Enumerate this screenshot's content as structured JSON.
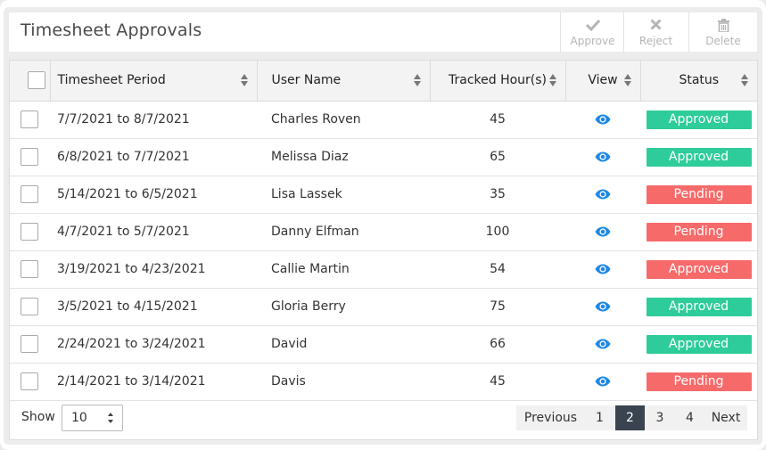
{
  "header": {
    "title": "Timesheet Approvals"
  },
  "toolbar": {
    "approve_label": "Approve",
    "reject_label": "Reject",
    "delete_label": "Delete"
  },
  "table": {
    "columns": {
      "period": "Timesheet Period",
      "user": "User Name",
      "hours": "Tracked Hour(s)",
      "view": "View",
      "status": "Status"
    },
    "rows": [
      {
        "period": "7/7/2021 to 8/7/2021",
        "user": "Charles Roven",
        "hours": "45",
        "status": "Approved",
        "status_color": "#2ecc9a"
      },
      {
        "period": "6/8/2021 to 7/7/2021",
        "user": "Melissa Diaz",
        "hours": "65",
        "status": "Approved",
        "status_color": "#2ecc9a"
      },
      {
        "period": "5/14/2021 to 6/5/2021",
        "user": "Lisa Lassek",
        "hours": "35",
        "status": "Pending",
        "status_color": "#f76a6a"
      },
      {
        "period": "4/7/2021 to 5/7/2021",
        "user": "Danny Elfman",
        "hours": "100",
        "status": "Pending",
        "status_color": "#f76a6a"
      },
      {
        "period": "3/19/2021 to 4/23/2021",
        "user": "Callie Martin",
        "hours": "54",
        "status": "Approved",
        "status_color": "#f76a6a"
      },
      {
        "period": "3/5/2021 to 4/15/2021",
        "user": "Gloria Berry",
        "hours": "75",
        "status": "Approved",
        "status_color": "#2ecc9a"
      },
      {
        "period": "2/24/2021 to 3/24/2021",
        "user": "David",
        "hours": "66",
        "status": "Approved",
        "status_color": "#2ecc9a"
      },
      {
        "period": "2/14/2021 to 3/14/2021",
        "user": "Davis",
        "hours": "45",
        "status": "Pending",
        "status_color": "#f76a6a"
      }
    ]
  },
  "footer": {
    "show_label": "Show",
    "page_size": "10",
    "pagination": {
      "previous": "Previous",
      "pages": [
        "1",
        "2",
        "3",
        "4"
      ],
      "current": "2",
      "next": "Next"
    }
  },
  "colors": {
    "approved": "#2ecc9a",
    "pending": "#f76a6a",
    "eye_icon": "#1e88e5",
    "active_page": "#3a4350"
  },
  "icons": {
    "approve": "check-icon",
    "reject": "x-icon",
    "delete": "trash-icon",
    "view": "eye-icon"
  }
}
